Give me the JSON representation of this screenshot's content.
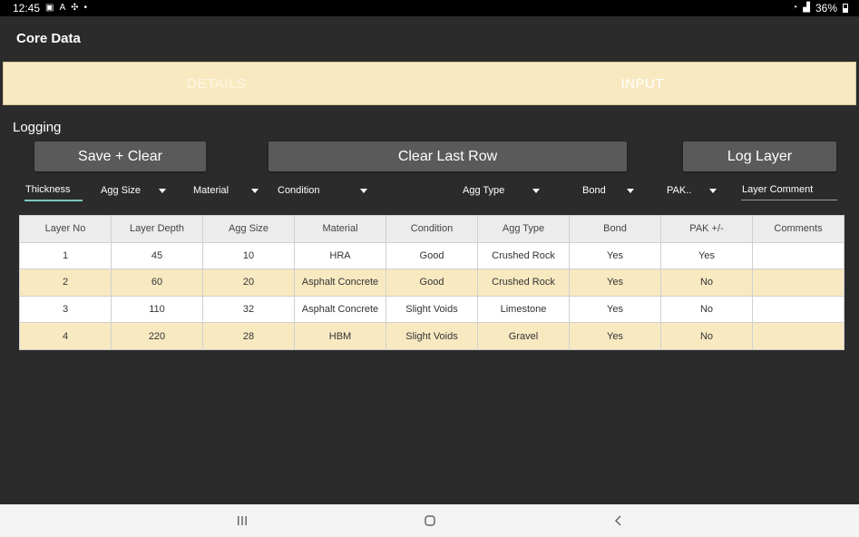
{
  "status": {
    "time": "12:45",
    "battery": "36%",
    "icons": [
      "image-icon",
      "text-icon",
      "fan-icon",
      "dot-icon",
      "wifi-icon",
      "signal-icon",
      "battery-icon"
    ]
  },
  "app": {
    "title": "Core Data"
  },
  "tabs": [
    {
      "label": "DETAILS",
      "active": false
    },
    {
      "label": "INPUT",
      "active": true
    }
  ],
  "section": {
    "label": "Logging"
  },
  "buttons": {
    "save_clear": "Save + Clear",
    "clear_last_row": "Clear Last Row",
    "log_layer": "Log Layer"
  },
  "inputs": {
    "thickness": "Thickness",
    "agg_size": "Agg Size",
    "material": "Material",
    "condition": "Condition",
    "agg_type": "Agg Type",
    "bond": "Bond",
    "pak": "PAK..",
    "layer_comment": "Layer Comment"
  },
  "table": {
    "headers": [
      "Layer No",
      "Layer Depth",
      "Agg Size",
      "Material",
      "Condition",
      "Agg Type",
      "Bond",
      "PAK +/-",
      "Comments"
    ],
    "rows": [
      [
        "1",
        "45",
        "10",
        "HRA",
        "Good",
        "Crushed Rock",
        "Yes",
        "Yes",
        ""
      ],
      [
        "2",
        "60",
        "20",
        "Asphalt Concrete",
        "Good",
        "Crushed Rock",
        "Yes",
        "No",
        ""
      ],
      [
        "3",
        "110",
        "32",
        "Asphalt Concrete",
        "Slight Voids",
        "Limestone",
        "Yes",
        "No",
        ""
      ],
      [
        "4",
        "220",
        "28",
        "HBM",
        "Slight Voids",
        "Gravel",
        "Yes",
        "No",
        ""
      ]
    ]
  },
  "colors": {
    "accent_tab": "#f8e9c1",
    "background": "#2b2b2b",
    "button": "#5a5a5a",
    "underline": "#7cc9c0"
  }
}
